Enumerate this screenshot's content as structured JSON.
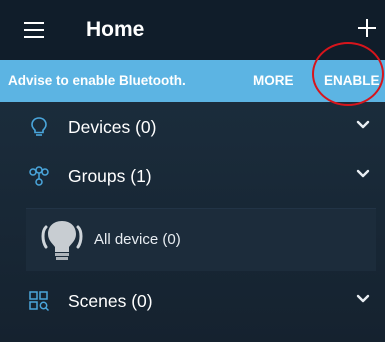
{
  "header": {
    "title": "Home",
    "menu_icon": "hamburger-menu-icon",
    "add_icon": "plus-icon"
  },
  "bluetooth_banner": {
    "message": "Advise to enable Bluetooth.",
    "more_label": "MORE",
    "enable_label": "ENABLE",
    "background": "#5cb4e3"
  },
  "sections": {
    "devices": {
      "label": "Devices (0)",
      "icon": "lightbulb-outline-icon"
    },
    "groups": {
      "label": "Groups (1)",
      "icon": "group-nodes-icon"
    },
    "scenes": {
      "label": "Scenes (0)",
      "icon": "scenes-grid-icon"
    }
  },
  "group_items": [
    {
      "label": "All device (0)",
      "icon": "bulb-icon"
    }
  ],
  "colors": {
    "accent": "#5cb4e3",
    "highlight": "#d7151c",
    "background": "#1a2b3a"
  }
}
